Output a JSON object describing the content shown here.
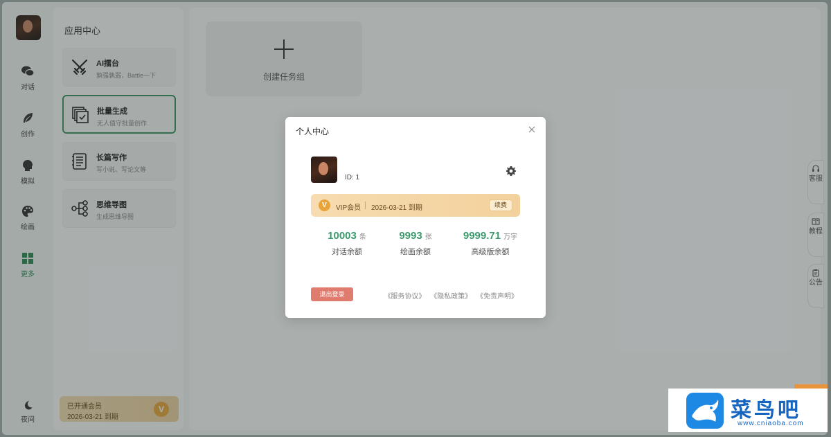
{
  "rail": {
    "items": [
      {
        "label": "对话"
      },
      {
        "label": "创作"
      },
      {
        "label": "模拟"
      },
      {
        "label": "绘画"
      },
      {
        "label": "更多"
      }
    ],
    "night_label": "夜间"
  },
  "panel": {
    "title": "应用中心",
    "cards": [
      {
        "title": "AI擂台",
        "subtitle": "孰强孰弱，Battle一下",
        "icon": "crossed-swords-icon"
      },
      {
        "title": "批量生成",
        "subtitle": "无人值守批量创作",
        "icon": "batch-copy-icon"
      },
      {
        "title": "长篇写作",
        "subtitle": "写小说、写论文等",
        "icon": "document-list-icon"
      },
      {
        "title": "思维导图",
        "subtitle": "生成思维导图",
        "icon": "mindmap-icon"
      }
    ],
    "member": {
      "title": "已开通会员",
      "expiry": "2026-03-21 到期",
      "badge": "V"
    }
  },
  "main": {
    "create_group_label": "创建任务组"
  },
  "side_tabs": [
    {
      "label": "客服",
      "icon": "headset-icon"
    },
    {
      "label": "教程",
      "icon": "book-icon"
    },
    {
      "label": "公告",
      "icon": "clipboard-icon"
    }
  ],
  "modal": {
    "title": "个人中心",
    "user_id": "ID: 1",
    "vip": {
      "badge": "V",
      "level": "VIP会员",
      "expiry": "2026-03-21 到期",
      "renew_label": "续费"
    },
    "stats": [
      {
        "value": "10003",
        "unit": "条",
        "label": "对话余额"
      },
      {
        "value": "9993",
        "unit": "张",
        "label": "绘画余额"
      },
      {
        "value": "9999.71",
        "unit": "万字",
        "label": "高级版余额"
      }
    ],
    "logout_label": "退出登录",
    "links": [
      "《服务协议》",
      "《隐私政策》",
      "《免责声明》"
    ]
  },
  "watermark": {
    "title": "菜鸟吧",
    "url": "www.cniaoba.com"
  },
  "colors": {
    "accent": "#3a9a6b",
    "vip_gold": "#e9a53b",
    "logout": "#e07c6f"
  }
}
